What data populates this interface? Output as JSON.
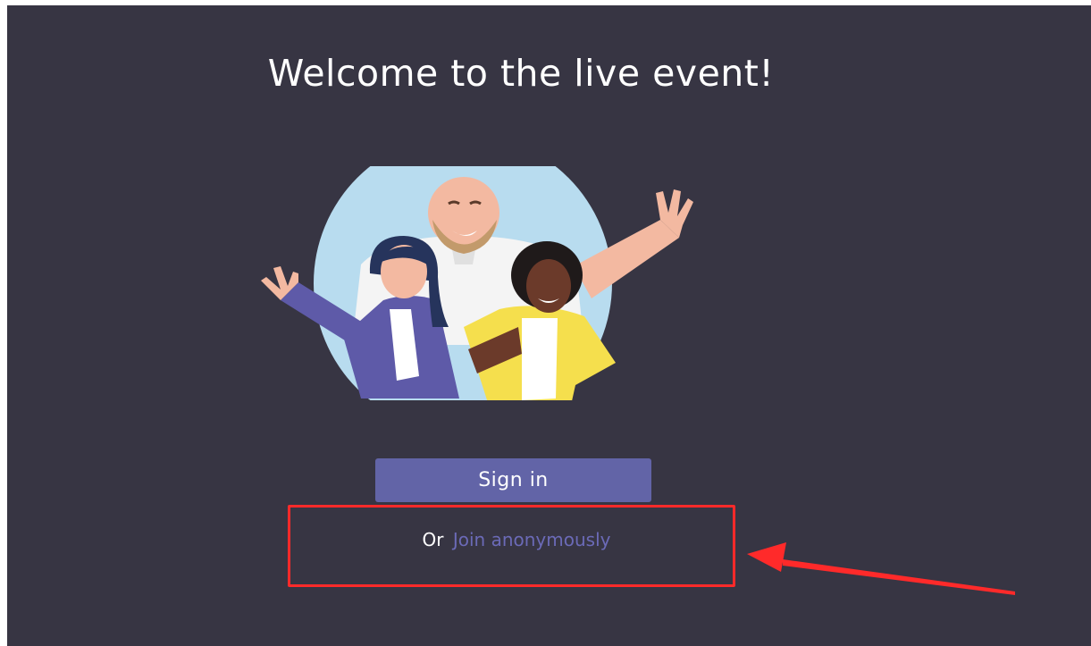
{
  "colors": {
    "background": "#373543",
    "accent": "#6264a7",
    "link": "#6b6ab7",
    "annotation": "#ff2a2a"
  },
  "page": {
    "title": "Welcome to the live event!"
  },
  "illustration": {
    "icon": "welcome-people-waving-illustration"
  },
  "actions": {
    "signin_label": "Sign in",
    "or_label": "Or",
    "join_label": "Join anonymously"
  },
  "annotation": {
    "box": "highlight-box",
    "arrow": "pointer-arrow"
  }
}
